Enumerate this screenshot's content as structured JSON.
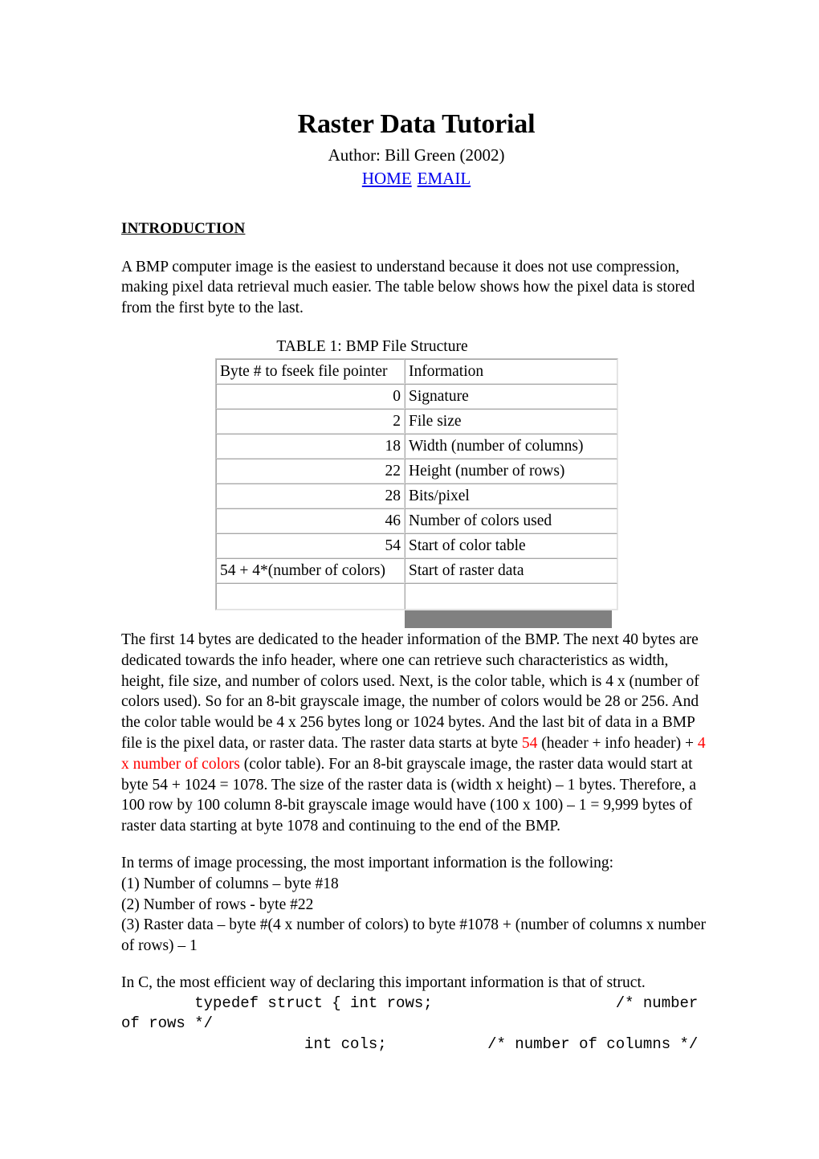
{
  "header": {
    "title": "Raster Data Tutorial",
    "author": "Author: Bill Green (2002)",
    "links": [
      {
        "label": "HOME"
      },
      {
        "label": "EMAIL"
      }
    ],
    "link_color": "#0000EE"
  },
  "sections": {
    "introduction": {
      "heading": "INTRODUCTION",
      "paragraph": "A BMP computer image is the easiest to understand because it does not use compression, making pixel data retrieval much easier. The table below shows how the pixel data is stored from the first byte to the last."
    }
  },
  "table": {
    "caption": "TABLE 1: BMP File Structure",
    "headers": [
      "Byte # to fseek file pointer",
      "Information"
    ],
    "rows": [
      {
        "byte": "0",
        "info": "Signature"
      },
      {
        "byte": "2",
        "info": "File size"
      },
      {
        "byte": "18",
        "info": "Width (number of columns)"
      },
      {
        "byte": "22",
        "info": "Height (number of rows)"
      },
      {
        "byte": "28",
        "info": "Bits/pixel"
      },
      {
        "byte": "46",
        "info": "Number of colors used"
      },
      {
        "byte": "54",
        "info": "Start of color table"
      },
      {
        "byte": "54 + 4*(number of colors)",
        "info": "Start of raster data"
      },
      {
        "byte": "",
        "info": ""
      }
    ],
    "shadow_color": "#808080"
  },
  "paragraphs": {
    "raster_explanation": {
      "part1": "The first 14 bytes are dedicated to the header information of the BMP. The next 40 bytes are dedicated towards the info header, where one can retrieve such characteristics as width, height, file size, and number of colors used. Next, is the color table, which is 4 x (number of colors used). So for an 8-bit grayscale image, the number of colors would be 28 or 256. And the color table would be 4 x 256 bytes long or 1024 bytes. And the last bit of data in a BMP file is the pixel data, or raster data. The raster data starts at byte ",
      "red1": "54",
      "part2": " (header + info header) + ",
      "red2": "4 x number of colors",
      "part3": " (color table). For an 8-bit grayscale image, the raster data would start at byte 54 + 1024 = 1078. The size of the raster data is (width x height) – 1 bytes. Therefore, a 100 row by 100 column 8-bit grayscale image would have (100 x 100) – 1 = 9,999 bytes of raster data starting at byte 1078 and continuing to the end of the BMP.",
      "red_color": "#FF0000"
    },
    "image_processing": {
      "intro": "In terms of image processing, the most important information is the following:",
      "item1": "(1) Number of columns – byte #18",
      "item2": "(2) Number of rows - byte #22",
      "item3": "(3) Raster data – byte #(4 x number of colors) to byte #1078 + (number of columns x number of rows) – 1"
    },
    "struct_intro": "In C, the most efficient way of declaring this important information is that of struct."
  },
  "code_block": {
    "text": "        typedef struct { int rows;                    /* number of rows */\n                    int cols;           /* number of columns */"
  }
}
